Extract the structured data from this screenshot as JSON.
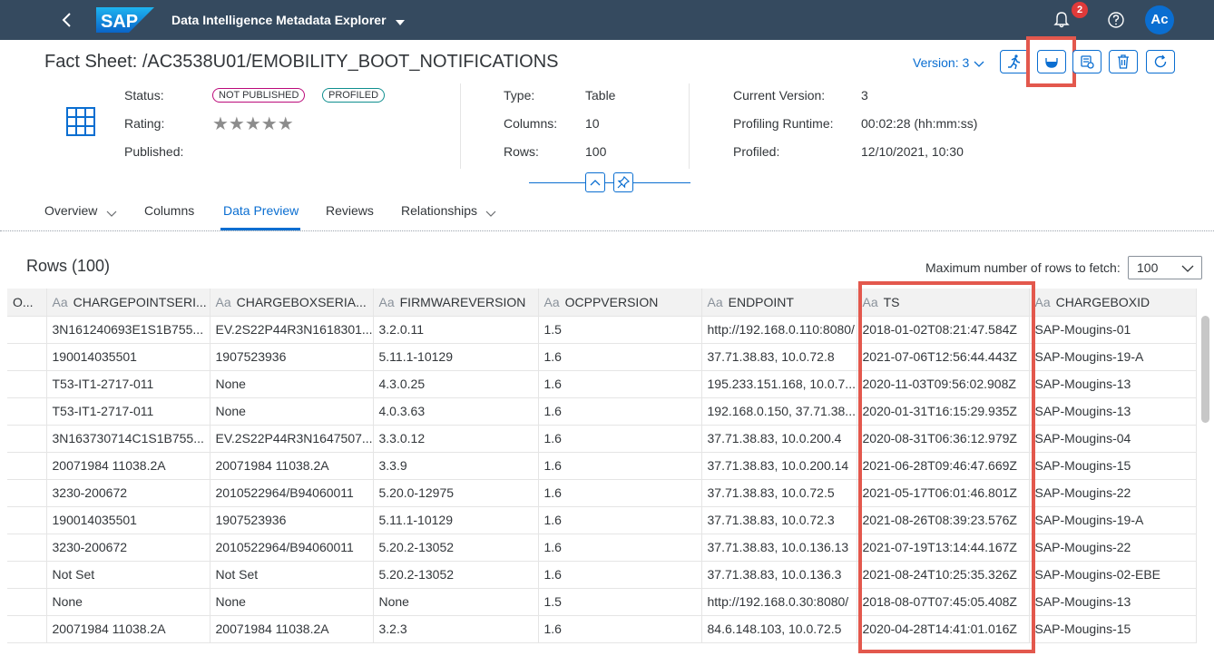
{
  "shell": {
    "logo_text": "SAP",
    "app_title": "Data Intelligence Metadata Explorer",
    "notification_count": "2",
    "avatar_initials": "Ac"
  },
  "header": {
    "title": "Fact Sheet: /AC3538U01/EMOBILITY_BOOT_NOTIFICATIONS",
    "version_label": "Version: 3",
    "col1": {
      "status_label": "Status:",
      "status_not_published": "NOT PUBLISHED",
      "status_profiled": "PROFILED",
      "rating_label": "Rating:",
      "rating_stars": "★★★★★",
      "published_label": "Published:"
    },
    "col2": {
      "type_label": "Type:",
      "type_value": "Table",
      "columns_label": "Columns:",
      "columns_value": "10",
      "rows_label": "Rows:",
      "rows_value": "100"
    },
    "col3": {
      "current_version_label": "Current Version:",
      "current_version_value": "3",
      "profiling_runtime_label": "Profiling Runtime:",
      "profiling_runtime_value": "00:02:28 (hh:mm:ss)",
      "profiled_label": "Profiled:",
      "profiled_value": "12/10/2021, 10:30"
    }
  },
  "tabs": [
    {
      "label": "Overview"
    },
    {
      "label": "Columns"
    },
    {
      "label": "Data Preview"
    },
    {
      "label": "Reviews"
    },
    {
      "label": "Relationships"
    }
  ],
  "preview": {
    "rows_title": "Rows (100)",
    "max_rows_label": "Maximum number of rows to fetch:",
    "max_rows_value": "100",
    "type_glyph": "Aa",
    "columns": [
      "O...",
      "CHARGEPOINTSERI...",
      "CHARGEBOXSERIA...",
      "FIRMWAREVERSION",
      "OCPPVERSION",
      "ENDPOINT",
      "TS",
      "CHARGEBOXID"
    ],
    "rows": [
      [
        "",
        "3N161240693E1S1B755...",
        "EV.2S22P44R3N1618301...",
        "3.2.0.11",
        "1.5",
        "http://192.168.0.110:8080/",
        "2018-01-02T08:21:47.584Z",
        "SAP-Mougins-01"
      ],
      [
        "",
        "190014035501",
        "1907523936",
        "5.11.1-10129",
        "1.6",
        "37.71.38.83, 10.0.72.8",
        "2021-07-06T12:56:44.443Z",
        "SAP-Mougins-19-A"
      ],
      [
        "",
        "T53-IT1-2717-011",
        "None",
        "4.3.0.25",
        "1.6",
        "195.233.151.168, 10.0.7...",
        "2020-11-03T09:56:02.908Z",
        "SAP-Mougins-13"
      ],
      [
        "",
        "T53-IT1-2717-011",
        "None",
        "4.0.3.63",
        "1.6",
        "192.168.0.150, 37.71.38....",
        "2020-01-31T16:15:29.935Z",
        "SAP-Mougins-13"
      ],
      [
        "",
        "3N163730714C1S1B755...",
        "EV.2S22P44R3N1647507...",
        "3.3.0.12",
        "1.6",
        "37.71.38.83, 10.0.200.4",
        "2020-08-31T06:36:12.979Z",
        "SAP-Mougins-04"
      ],
      [
        "",
        "20071984 11038.2A",
        "20071984 11038.2A",
        "3.3.9",
        "1.6",
        "37.71.38.83, 10.0.200.14",
        "2021-06-28T09:46:47.669Z",
        "SAP-Mougins-15"
      ],
      [
        "",
        "3230-200672",
        "2010522964/B94060011",
        "5.20.0-12975",
        "1.6",
        "37.71.38.83, 10.0.72.5",
        "2021-05-17T06:01:46.801Z",
        "SAP-Mougins-22"
      ],
      [
        "",
        "190014035501",
        "1907523936",
        "5.11.1-10129",
        "1.6",
        "37.71.38.83, 10.0.72.3",
        "2021-08-26T08:39:23.576Z",
        "SAP-Mougins-19-A"
      ],
      [
        "",
        "3230-200672",
        "2010522964/B94060011",
        "5.20.2-13052",
        "1.6",
        "37.71.38.83, 10.0.136.13",
        "2021-07-19T13:14:44.167Z",
        "SAP-Mougins-22"
      ],
      [
        "",
        "Not Set",
        "Not Set",
        "5.20.2-13052",
        "1.6",
        "37.71.38.83, 10.0.136.3",
        "2021-08-24T10:25:35.326Z",
        "SAP-Mougins-02-EBE"
      ],
      [
        "",
        "None",
        "None",
        "None",
        "1.5",
        "http://192.168.0.30:8080/",
        "2018-08-07T07:45:05.408Z",
        "SAP-Mougins-13"
      ],
      [
        "",
        "20071984 11038.2A",
        "20071984 11038.2A",
        "3.2.3",
        "1.6",
        "84.6.148.103, 10.0.72.5",
        "2020-04-28T14:41:01.016Z",
        "SAP-Mougins-15"
      ]
    ]
  },
  "colors": {
    "shell_bg": "#354a5f",
    "accent": "#0a6ed1",
    "highlight": "#e3584d"
  }
}
